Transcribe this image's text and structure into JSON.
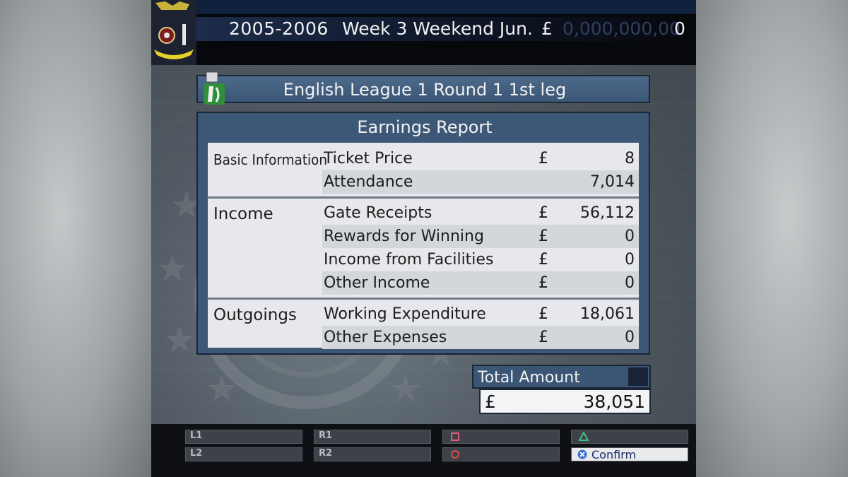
{
  "header": {
    "season": "2005-2006",
    "week": "Week 3 Weekend Jun.",
    "currency": "£",
    "money_placeholder": "0,000,000,00",
    "money_value": "0"
  },
  "match": {
    "title": "English League 1  Round  1  1st leg"
  },
  "report": {
    "title": "Earnings Report",
    "sections": {
      "basic": "Basic Information",
      "income": "Income",
      "outgoings": "Outgoings"
    },
    "rows": [
      {
        "label": "Ticket Price",
        "currency": "£",
        "value": "8"
      },
      {
        "label": "Attendance",
        "currency": "",
        "value": "7,014"
      },
      {
        "label": "Gate Receipts",
        "currency": "£",
        "value": "56,112"
      },
      {
        "label": "Rewards for Winning",
        "currency": "£",
        "value": "0"
      },
      {
        "label": "Income from Facilities",
        "currency": "£",
        "value": "0"
      },
      {
        "label": "Other Income",
        "currency": "£",
        "value": "0"
      },
      {
        "label": "Working Expenditure",
        "currency": "£",
        "value": "18,061"
      },
      {
        "label": "Other Expenses",
        "currency": "£",
        "value": "0"
      }
    ]
  },
  "total": {
    "label": "Total Amount",
    "currency": "£",
    "value": "38,051"
  },
  "controls": {
    "l1": "L1",
    "l2": "L2",
    "r1": "R1",
    "r2": "R2",
    "square_icon": "square-button-icon",
    "circle_icon": "circle-button-icon",
    "triangle_icon": "triangle-button-icon",
    "cross_icon": "cross-button-icon",
    "confirm": "Confirm"
  },
  "colors": {
    "panel_blue": "#3d5877",
    "row_light": "#e6e8eb",
    "row_alt": "#d3d6da",
    "square": "#e05a7a",
    "circle": "#e04848",
    "triangle": "#3fbf8a",
    "cross": "#3b6fd6"
  }
}
